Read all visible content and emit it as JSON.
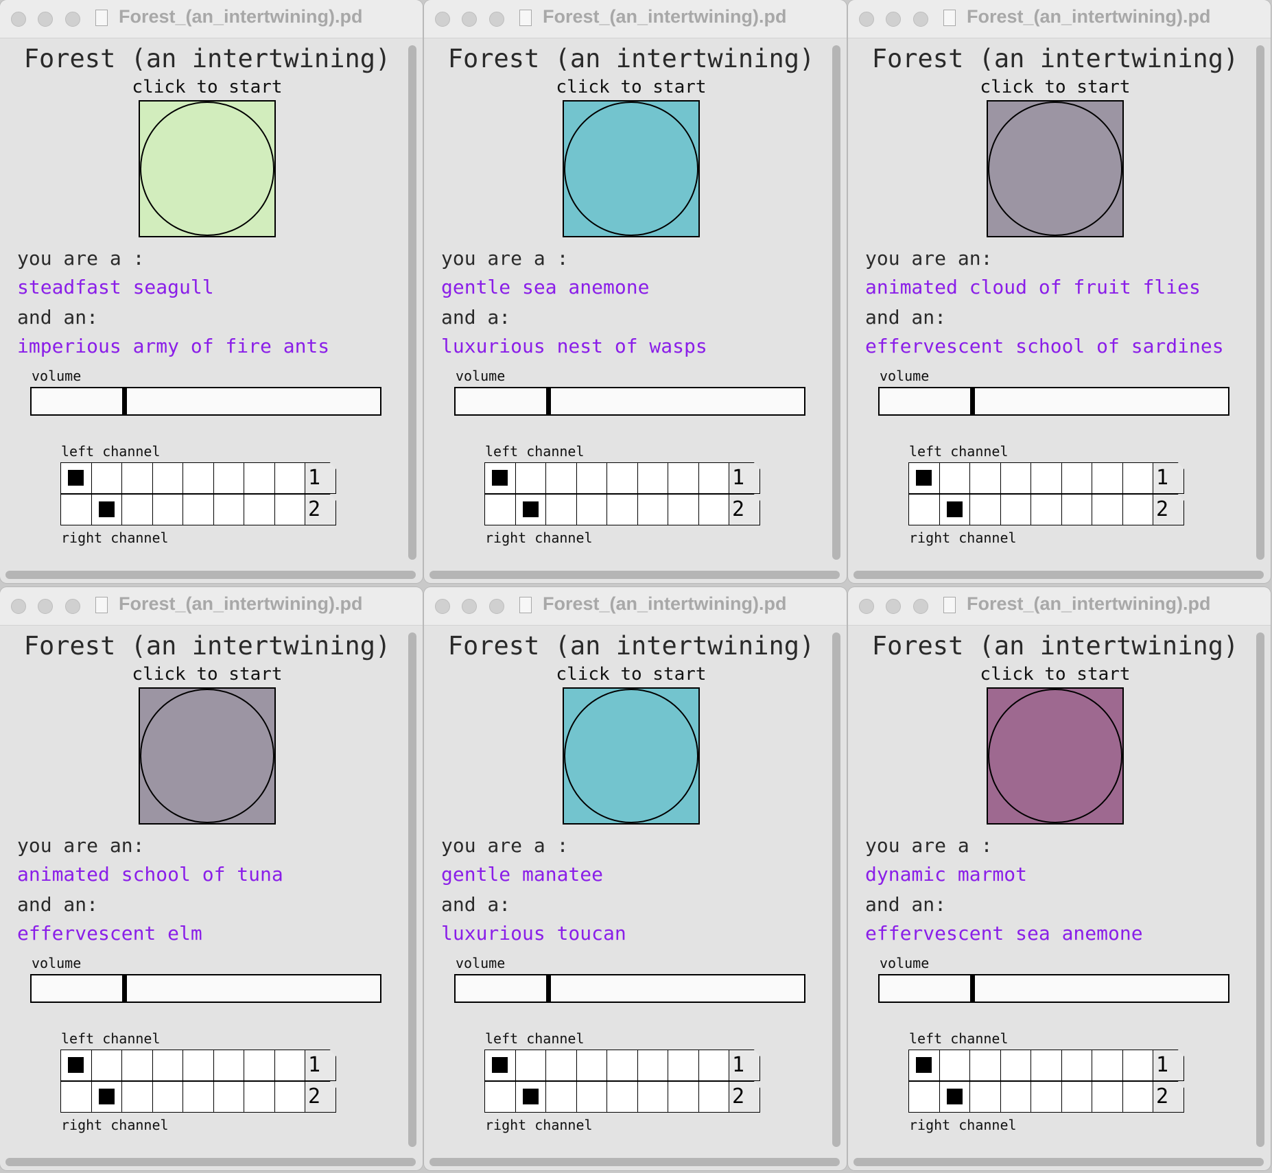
{
  "windows": [
    {
      "window_title": "Forest_(an_intertwining).pd",
      "page_title": "Forest (an intertwining)",
      "click_to_start": "click to start",
      "bang_color": "#d2edbd",
      "you_are_label": "you are a :",
      "you_are_value": "steadfast seagull",
      "and_label": "and an:",
      "and_value": "imperious army of fire ants",
      "volume_label": "volume",
      "volume_value": 0.26,
      "left_channel_label": "left channel",
      "right_channel_label": "right channel",
      "row1_number": "1",
      "row2_number": "2",
      "left_channel_selected": 1,
      "right_channel_selected": 2
    },
    {
      "window_title": "Forest_(an_intertwining).pd",
      "page_title": "Forest (an intertwining)",
      "click_to_start": "click to start",
      "bang_color": "#73c4ce",
      "you_are_label": "you are a :",
      "you_are_value": "gentle sea anemone",
      "and_label": "and a:",
      "and_value": "luxurious nest of wasps",
      "volume_label": "volume",
      "volume_value": 0.26,
      "left_channel_label": "left channel",
      "right_channel_label": "right channel",
      "row1_number": "1",
      "row2_number": "2",
      "left_channel_selected": 1,
      "right_channel_selected": 2
    },
    {
      "window_title": "Forest_(an_intertwining).pd",
      "page_title": "Forest (an intertwining)",
      "click_to_start": "click to start",
      "bang_color": "#9c95a3",
      "you_are_label": "you are an:",
      "you_are_value": "animated cloud of fruit flies",
      "and_label": "and an:",
      "and_value": "effervescent school of sardines",
      "volume_label": "volume",
      "volume_value": 0.26,
      "left_channel_label": "left channel",
      "right_channel_label": "right channel",
      "row1_number": "1",
      "row2_number": "2",
      "left_channel_selected": 1,
      "right_channel_selected": 2
    },
    {
      "window_title": "Forest_(an_intertwining).pd",
      "page_title": "Forest (an intertwining)",
      "click_to_start": "click to start",
      "bang_color": "#9c95a3",
      "you_are_label": "you are an:",
      "you_are_value": "animated school of tuna",
      "and_label": "and an:",
      "and_value": "effervescent elm",
      "volume_label": "volume",
      "volume_value": 0.26,
      "left_channel_label": "left channel",
      "right_channel_label": "right channel",
      "row1_number": "1",
      "row2_number": "2",
      "left_channel_selected": 1,
      "right_channel_selected": 2
    },
    {
      "window_title": "Forest_(an_intertwining).pd",
      "page_title": "Forest (an intertwining)",
      "click_to_start": "click to start",
      "bang_color": "#73c4ce",
      "you_are_label": "you are a :",
      "you_are_value": "gentle manatee",
      "and_label": "and a:",
      "and_value": "luxurious toucan",
      "volume_label": "volume",
      "volume_value": 0.26,
      "left_channel_label": "left channel",
      "right_channel_label": "right channel",
      "row1_number": "1",
      "row2_number": "2",
      "left_channel_selected": 1,
      "right_channel_selected": 2
    },
    {
      "window_title": "Forest_(an_intertwining).pd",
      "page_title": "Forest (an intertwining)",
      "click_to_start": "click to start",
      "bang_color": "#9e6990",
      "you_are_label": "you are a :",
      "you_are_value": "dynamic marmot",
      "and_label": "and an:",
      "and_value": "effervescent sea anemone",
      "volume_label": "volume",
      "volume_value": 0.26,
      "left_channel_label": "left channel",
      "right_channel_label": "right channel",
      "row1_number": "1",
      "row2_number": "2",
      "left_channel_selected": 1,
      "right_channel_selected": 2
    }
  ],
  "colors": {
    "value_text": "#8a1ee8",
    "window_bg": "#e3e3e3"
  }
}
